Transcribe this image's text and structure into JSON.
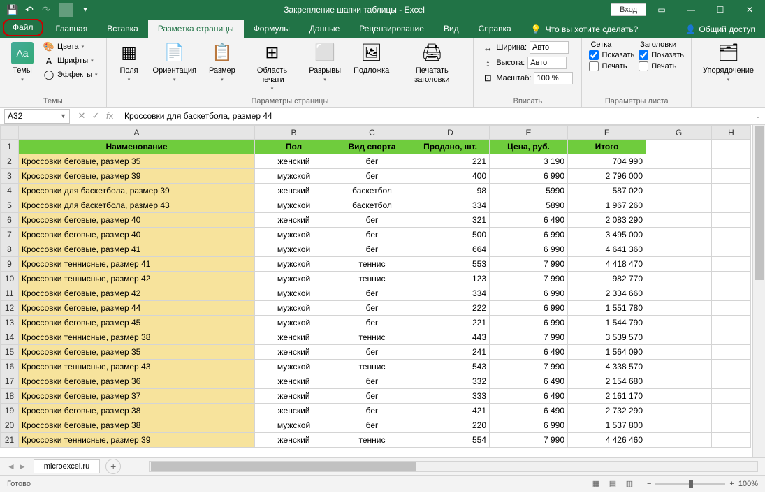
{
  "title": "Закрепление шапки таблицы  -  Excel",
  "login": "Вход",
  "tabs": {
    "file": "Файл",
    "home": "Главная",
    "insert": "Вставка",
    "layout": "Разметка страницы",
    "formulas": "Формулы",
    "data": "Данные",
    "review": "Рецензирование",
    "view": "Вид",
    "help": "Справка"
  },
  "tellme": "Что вы хотите сделать?",
  "share": "Общий доступ",
  "ribbon": {
    "themes": {
      "label": "Темы",
      "themes": "Темы",
      "colors": "Цвета",
      "fonts": "Шрифты",
      "effects": "Эффекты"
    },
    "page": {
      "label": "Параметры страницы",
      "margins": "Поля",
      "orient": "Ориентация",
      "size": "Размер",
      "area": "Область печати",
      "breaks": "Разрывы",
      "bg": "Подложка",
      "titles": "Печатать заголовки"
    },
    "fit": {
      "label": "Вписать",
      "width": "Ширина:",
      "height": "Высота:",
      "scale": "Масштаб:",
      "auto": "Авто",
      "scaleval": "100 %"
    },
    "sheet": {
      "label": "Параметры листа",
      "grid": "Сетка",
      "headers": "Заголовки",
      "show": "Показать",
      "print": "Печать"
    },
    "arrange": {
      "label": "",
      "btn": "Упорядочение"
    }
  },
  "namebox": "A32",
  "formula": "Кроссовки для баскетбола, размер 44",
  "cols": [
    "A",
    "B",
    "C",
    "D",
    "E",
    "F",
    "G",
    "H"
  ],
  "headers": [
    "Наименование",
    "Пол",
    "Вид спорта",
    "Продано, шт.",
    "Цена, руб.",
    "Итого"
  ],
  "rows": [
    {
      "r": 2,
      "n": "Кроссовки беговые, размер 35",
      "g": "женский",
      "s": "бег",
      "q": "221",
      "p": "3 190",
      "t": "704 990"
    },
    {
      "r": 3,
      "n": "Кроссовки беговые, размер 39",
      "g": "мужской",
      "s": "бег",
      "q": "400",
      "p": "6 990",
      "t": "2 796 000"
    },
    {
      "r": 4,
      "n": "Кроссовки для баскетбола, размер 39",
      "g": "женский",
      "s": "баскетбол",
      "q": "98",
      "p": "5990",
      "t": "587 020"
    },
    {
      "r": 5,
      "n": "Кроссовки для баскетбола, размер 43",
      "g": "мужской",
      "s": "баскетбол",
      "q": "334",
      "p": "5890",
      "t": "1 967 260"
    },
    {
      "r": 6,
      "n": "Кроссовки беговые, размер 40",
      "g": "женский",
      "s": "бег",
      "q": "321",
      "p": "6 490",
      "t": "2 083 290"
    },
    {
      "r": 7,
      "n": "Кроссовки беговые, размер 40",
      "g": "мужской",
      "s": "бег",
      "q": "500",
      "p": "6 990",
      "t": "3 495 000"
    },
    {
      "r": 8,
      "n": "Кроссовки беговые, размер 41",
      "g": "мужской",
      "s": "бег",
      "q": "664",
      "p": "6 990",
      "t": "4 641 360"
    },
    {
      "r": 9,
      "n": "Кроссовки теннисные, размер 41",
      "g": "мужской",
      "s": "теннис",
      "q": "553",
      "p": "7 990",
      "t": "4 418 470"
    },
    {
      "r": 10,
      "n": "Кроссовки теннисные, размер 42",
      "g": "мужской",
      "s": "теннис",
      "q": "123",
      "p": "7 990",
      "t": "982 770"
    },
    {
      "r": 11,
      "n": "Кроссовки беговые, размер 42",
      "g": "мужской",
      "s": "бег",
      "q": "334",
      "p": "6 990",
      "t": "2 334 660"
    },
    {
      "r": 12,
      "n": "Кроссовки беговые, размер 44",
      "g": "мужской",
      "s": "бег",
      "q": "222",
      "p": "6 990",
      "t": "1 551 780"
    },
    {
      "r": 13,
      "n": "Кроссовки беговые, размер 45",
      "g": "мужской",
      "s": "бег",
      "q": "221",
      "p": "6 990",
      "t": "1 544 790"
    },
    {
      "r": 14,
      "n": "Кроссовки теннисные, размер 38",
      "g": "женский",
      "s": "теннис",
      "q": "443",
      "p": "7 990",
      "t": "3 539 570"
    },
    {
      "r": 15,
      "n": "Кроссовки беговые, размер 35",
      "g": "женский",
      "s": "бег",
      "q": "241",
      "p": "6 490",
      "t": "1 564 090"
    },
    {
      "r": 16,
      "n": "Кроссовки теннисные, размер 43",
      "g": "мужской",
      "s": "теннис",
      "q": "543",
      "p": "7 990",
      "t": "4 338 570"
    },
    {
      "r": 17,
      "n": "Кроссовки беговые, размер 36",
      "g": "женский",
      "s": "бег",
      "q": "332",
      "p": "6 490",
      "t": "2 154 680"
    },
    {
      "r": 18,
      "n": "Кроссовки беговые, размер 37",
      "g": "женский",
      "s": "бег",
      "q": "333",
      "p": "6 490",
      "t": "2 161 170"
    },
    {
      "r": 19,
      "n": "Кроссовки беговые, размер 38",
      "g": "женский",
      "s": "бег",
      "q": "421",
      "p": "6 490",
      "t": "2 732 290"
    },
    {
      "r": 20,
      "n": "Кроссовки беговые, размер 38",
      "g": "мужской",
      "s": "бег",
      "q": "220",
      "p": "6 990",
      "t": "1 537 800"
    },
    {
      "r": 21,
      "n": "Кроссовки теннисные, размер 39",
      "g": "женский",
      "s": "теннис",
      "q": "554",
      "p": "7 990",
      "t": "4 426 460"
    }
  ],
  "sheetname": "microexcel.ru",
  "status": "Готово",
  "zoom": "100%"
}
